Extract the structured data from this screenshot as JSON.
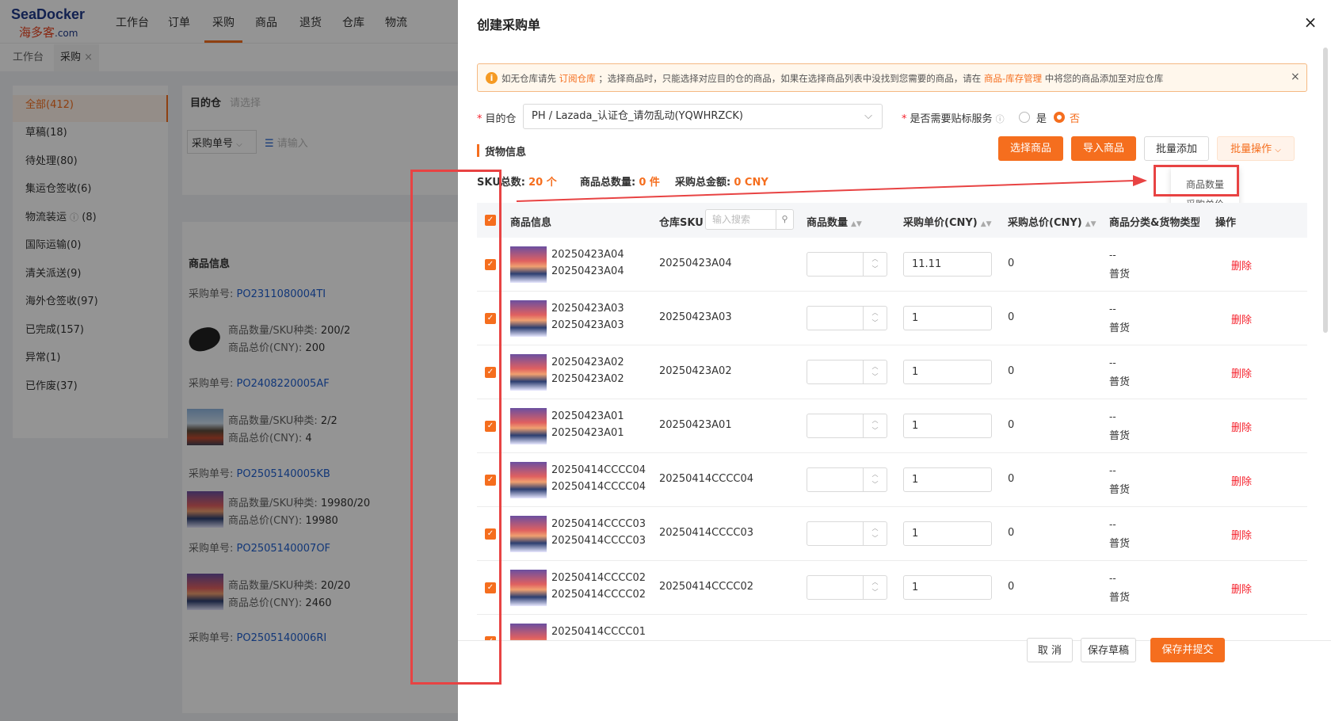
{
  "app": {
    "logo_top": "SeaDocker",
    "logo_cn": "海多客",
    "logo_suffix": ".com",
    "nav": [
      "工作台",
      "订单",
      "采购",
      "商品",
      "退货",
      "仓库",
      "物流"
    ],
    "page_tabs": [
      "工作台",
      "采购"
    ],
    "page_tab_close": "×",
    "sidebar": [
      "全部(412)",
      "草稿(18)",
      "待处理(80)",
      "集运仓签收(6)",
      "物流装运",
      "(8)",
      "国际运输(0)",
      "清关派送(9)",
      "海外仓签收(97)",
      "已完成(157)",
      "异常(1)",
      "已作废(37)"
    ],
    "filter": {
      "dest_label": "目的仓",
      "dest_placeholder": "请选择",
      "po_select": "采购单号",
      "po_placeholder": "请输入"
    },
    "list_header": "商品信息",
    "orders": [
      {
        "po_label": "采购单号:",
        "po": "PO2311080004TI",
        "qty_label": "商品数量/SKU种类:",
        "qty": "200/2",
        "total_label": "商品总价(CNY):",
        "total": "200"
      },
      {
        "po_label": "采购单号:",
        "po": "PO2408220005AF",
        "qty_label": "商品数量/SKU种类:",
        "qty": "2/2",
        "total_label": "商品总价(CNY):",
        "total": "4"
      },
      {
        "po_label": "采购单号:",
        "po": "PO2505140005KB",
        "qty_label": "商品数量/SKU种类:",
        "qty": "19980/20",
        "total_label": "商品总价(CNY):",
        "total": "19980"
      },
      {
        "po_label": "采购单号:",
        "po": "PO2505140007OF",
        "qty_label": "商品数量/SKU种类:",
        "qty": "20/20",
        "total_label": "商品总价(CNY):",
        "total": "2460"
      },
      {
        "po_label": "采购单号:",
        "po": "PO2505140006RI"
      }
    ]
  },
  "drawer": {
    "title": "创建采购单",
    "close": "×",
    "alert": {
      "icon": "i",
      "t1": "如无仓库请先",
      "link1": "订阅仓库",
      "t2": "；选择商品时，只能选择对应目的仓的商品，如果在选择商品列表中没找到您需要的商品，请在",
      "link2": "商品-库存管理",
      "t3": "中将您的商品添加至对应仓库",
      "close": "×"
    },
    "dest_label": "目的仓",
    "dest_value": "PH / Lazada_认证仓_请勿乱动(YQWHRZCK)",
    "label_service": "是否需要贴标服务",
    "yes": "是",
    "no": "否",
    "section_title": "货物信息",
    "buttons": {
      "select": "选择商品",
      "import": "导入商品",
      "batch_add": "批量添加",
      "batch_op": "批量操作"
    },
    "dropdown": [
      "商品数量",
      "采购单价"
    ],
    "stats": {
      "sku_label": "SKU总数:",
      "sku": "20 个",
      "qty_label": "商品总数量:",
      "qty": "0 件",
      "amount_label": "采购总金额:",
      "amount": "0 CNY"
    },
    "columns": {
      "info": "商品信息",
      "sku": "仓库SKU",
      "sku_search": "输入搜索",
      "qty": "商品数量",
      "price": "采购单价(CNY)",
      "total": "采购总价(CNY)",
      "cat": "商品分类&货物类型",
      "op": "操作"
    },
    "rows": [
      {
        "n1": "20250423A04",
        "n2": "20250423A04",
        "sku": "20250423A04",
        "price": "11.11",
        "total": "0",
        "c1": "--",
        "c2": "普货",
        "del": "删除"
      },
      {
        "n1": "20250423A03",
        "n2": "20250423A03",
        "sku": "20250423A03",
        "price": "1",
        "total": "0",
        "c1": "--",
        "c2": "普货",
        "del": "删除"
      },
      {
        "n1": "20250423A02",
        "n2": "20250423A02",
        "sku": "20250423A02",
        "price": "1",
        "total": "0",
        "c1": "--",
        "c2": "普货",
        "del": "删除"
      },
      {
        "n1": "20250423A01",
        "n2": "20250423A01",
        "sku": "20250423A01",
        "price": "1",
        "total": "0",
        "c1": "--",
        "c2": "普货",
        "del": "删除"
      },
      {
        "n1": "20250414CCCC04",
        "n2": "20250414CCCC04",
        "sku": "20250414CCCC04",
        "price": "1",
        "total": "0",
        "c1": "--",
        "c2": "普货",
        "del": "删除"
      },
      {
        "n1": "20250414CCCC03",
        "n2": "20250414CCCC03",
        "sku": "20250414CCCC03",
        "price": "1",
        "total": "0",
        "c1": "--",
        "c2": "普货",
        "del": "删除"
      },
      {
        "n1": "20250414CCCC02",
        "n2": "20250414CCCC02",
        "sku": "20250414CCCC02",
        "price": "1",
        "total": "0",
        "c1": "--",
        "c2": "普货",
        "del": "删除"
      },
      {
        "n1": "20250414CCCC01"
      }
    ],
    "footer": {
      "cancel": "取 消",
      "save_draft": "保存草稿",
      "submit": "保存并提交"
    }
  },
  "colors": {
    "accent": "#f56e1e",
    "danger": "#f5222d",
    "annotation": "#e84343"
  }
}
